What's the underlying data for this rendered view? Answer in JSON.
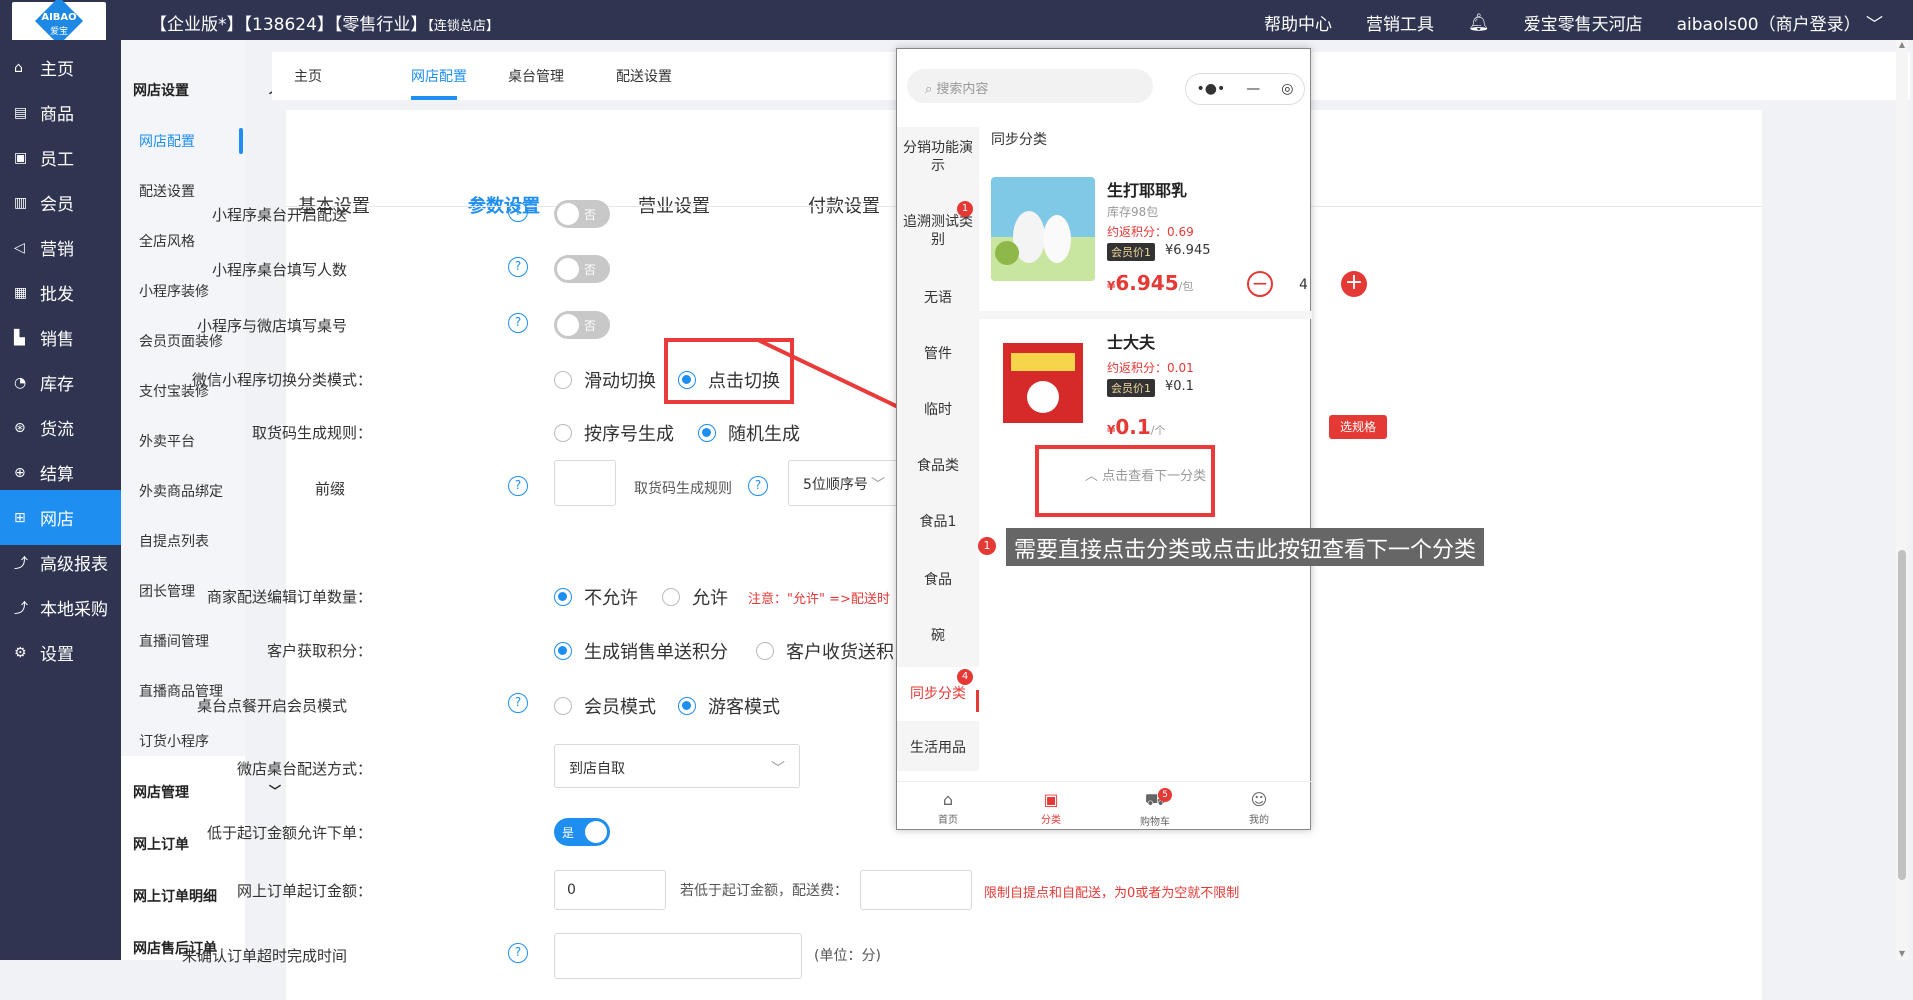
{
  "header": {
    "logo_text": "AIBAO",
    "logo_sub": "爱宝",
    "title": "【企业版*】【138624】【零售行业】",
    "title_small": "【连锁总店】",
    "help": "帮助中心",
    "marketing": "营销工具",
    "store": "爱宝零售天河店",
    "account": "aibaols00（商户登录）",
    "chevron": "﹀"
  },
  "sidenav": {
    "items": [
      {
        "label": "主页",
        "icon": "home-icon"
      },
      {
        "label": "商品",
        "icon": "goods-icon"
      },
      {
        "label": "员工",
        "icon": "staff-icon"
      },
      {
        "label": "会员",
        "icon": "member-icon"
      },
      {
        "label": "营销",
        "icon": "megaphone-icon"
      },
      {
        "label": "批发",
        "icon": "wholesale-icon"
      },
      {
        "label": "销售",
        "icon": "chart-icon"
      },
      {
        "label": "库存",
        "icon": "stock-icon"
      },
      {
        "label": "货流",
        "icon": "flow-icon"
      },
      {
        "label": "结算",
        "icon": "settle-icon"
      },
      {
        "label": "网店",
        "icon": "shop-icon"
      },
      {
        "label": "高级报表",
        "icon": "report-icon"
      },
      {
        "label": "本地采购",
        "icon": "purchase-icon"
      },
      {
        "label": "设置",
        "icon": "gear-icon"
      }
    ]
  },
  "subnav": {
    "group1": "网店设置",
    "items": [
      "网店配置",
      "配送设置",
      "全店风格",
      "小程序装修",
      "会员页面装修",
      "支付宝装修",
      "外卖平台",
      "外卖商品绑定",
      "自提点列表",
      "团长管理",
      "直播间管理",
      "直播商品管理",
      "订货小程序"
    ],
    "group2": "网店管理",
    "plain": [
      "网上订单",
      "网上订单明细",
      "网店售后订单"
    ]
  },
  "tabs": [
    "主页",
    "网店配置",
    "桌台管理",
    "配送设置"
  ],
  "panel_tabs": [
    "基本设置",
    "参数设置",
    "营业设置",
    "付款设置"
  ],
  "form": {
    "desk_delivery": {
      "label": "小程序桌台开启配送",
      "value": "否"
    },
    "desk_people": {
      "label": "小程序桌台填写人数",
      "value": "否"
    },
    "desk_number": {
      "label": "小程序与微店填写桌号",
      "value": "否"
    },
    "switch_mode": {
      "label": "微信小程序切换分类模式：",
      "opt1": "滑动切换",
      "opt2": "点击切换"
    },
    "pickup_rule": {
      "label": "取货码生成规则：",
      "opt1": "按序号生成",
      "opt2": "随机生成"
    },
    "prefix": {
      "label": "前缀",
      "rule_label": "取货码生成规则",
      "rule_value": "5位顺序号"
    },
    "edit_qty": {
      "label": "商家配送编辑订单数量：",
      "opt1": "不允许",
      "opt2": "允许",
      "note": "注意：\"允许\" =>配送时"
    },
    "points": {
      "label": "客户获取积分：",
      "opt1": "生成销售单送积分",
      "opt2": "客户收货送积"
    },
    "member_mode": {
      "label": "桌台点餐开启会员模式",
      "opt1": "会员模式",
      "opt2": "游客模式"
    },
    "delivery_way": {
      "label": "微店桌台配送方式：",
      "value": "到店自取"
    },
    "below_min": {
      "label": "低于起订金额允许下单：",
      "value": "是"
    },
    "min_amount": {
      "label": "网上订单起订金额：",
      "value": "0",
      "fee_label": "若低于起订金额，配送费：",
      "note": "限制自提点和自配送，为0或者为空就不限制"
    },
    "timeout": {
      "label": "未确认订单超时完成时间",
      "unit": "(单位：分)"
    }
  },
  "phone": {
    "search_placeholder": "搜索内容",
    "capsule": [
      "•●•",
      "—",
      "◎"
    ],
    "categories": [
      "分销功能演示",
      "追溯测试类别",
      "无语",
      "管件",
      "临时",
      "食品类",
      "食品1",
      "食品",
      "碗",
      "同步分类",
      "生活用品"
    ],
    "badge_trace": "1",
    "badge_sync": "4",
    "section": "同步分类",
    "products": [
      {
        "name": "生打耶耶乳",
        "stock": "库存98包",
        "points": "约返积分：0.69",
        "member_tag": "会员价1",
        "member_price": "¥6.945",
        "currency": "¥",
        "price": "6.945",
        "unit": "/包",
        "qty": "4"
      },
      {
        "name": "士大夫",
        "points": "约返积分：0.01",
        "member_tag": "会员价1",
        "member_price": "¥0.1",
        "currency": "¥",
        "price": "0.1",
        "unit": "/个",
        "spec": "选规格"
      }
    ],
    "next": "点击查看下一分类",
    "tabbar": [
      "首页",
      "分类",
      "购物车",
      "我的"
    ],
    "cart_badge": "5"
  },
  "tooltip": {
    "num": "1",
    "text": "需要直接点击分类或点击此按钮查看下一个分类"
  },
  "colors": {
    "primary": "#1f8ef1",
    "nav_bg": "#2f3551",
    "alert": "#ea3a3a"
  }
}
